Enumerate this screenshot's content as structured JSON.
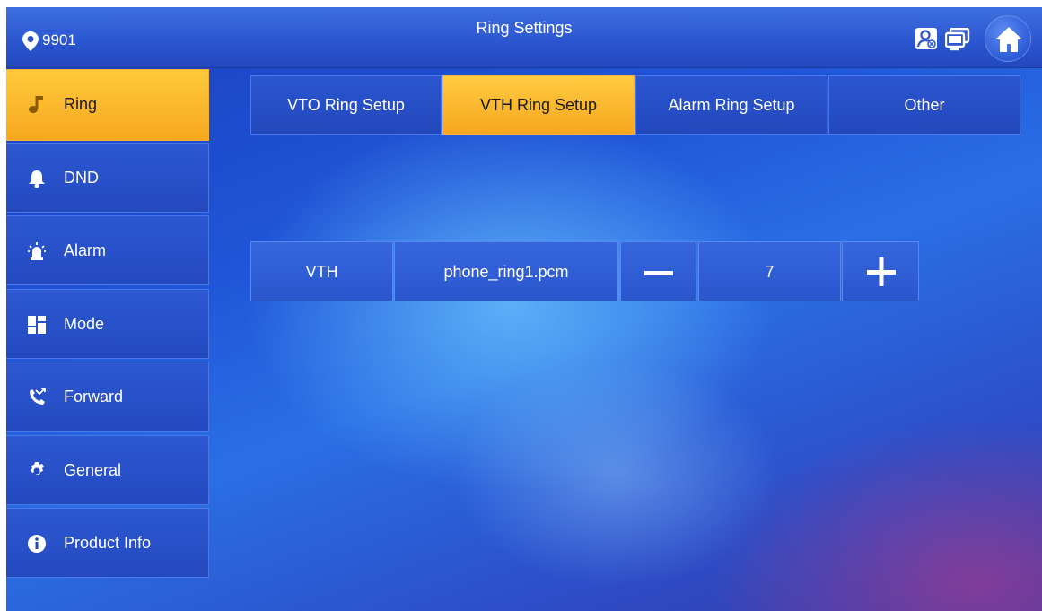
{
  "header": {
    "room_number": "9901",
    "title": "Ring Settings",
    "icons": [
      "location-pin-icon",
      "contacts-icon",
      "monitor-icon",
      "home-icon"
    ]
  },
  "sidebar": {
    "items": [
      {
        "label": "Ring",
        "icon": "music-note-icon",
        "active": true
      },
      {
        "label": "DND",
        "icon": "bell-icon",
        "active": false
      },
      {
        "label": "Alarm",
        "icon": "alarm-siren-icon",
        "active": false
      },
      {
        "label": "Mode",
        "icon": "mode-grid-icon",
        "active": false
      },
      {
        "label": "Forward",
        "icon": "call-forward-icon",
        "active": false
      },
      {
        "label": "General",
        "icon": "gear-icon",
        "active": false
      },
      {
        "label": "Product Info",
        "icon": "info-icon",
        "active": false
      }
    ]
  },
  "tabs": [
    {
      "label": "VTO Ring Setup",
      "active": false
    },
    {
      "label": "VTH Ring Setup",
      "active": true
    },
    {
      "label": "Alarm Ring Setup",
      "active": false
    },
    {
      "label": "Other",
      "active": false
    }
  ],
  "ring_row": {
    "device": "VTH",
    "ringtone": "phone_ring1.pcm",
    "volume": "7",
    "decrease_icon": "minus-icon",
    "increase_icon": "plus-icon"
  },
  "colors": {
    "active_yellow": "#f7a81f",
    "panel_blue": "#2449bf",
    "background_blue": "#1f55d8"
  }
}
